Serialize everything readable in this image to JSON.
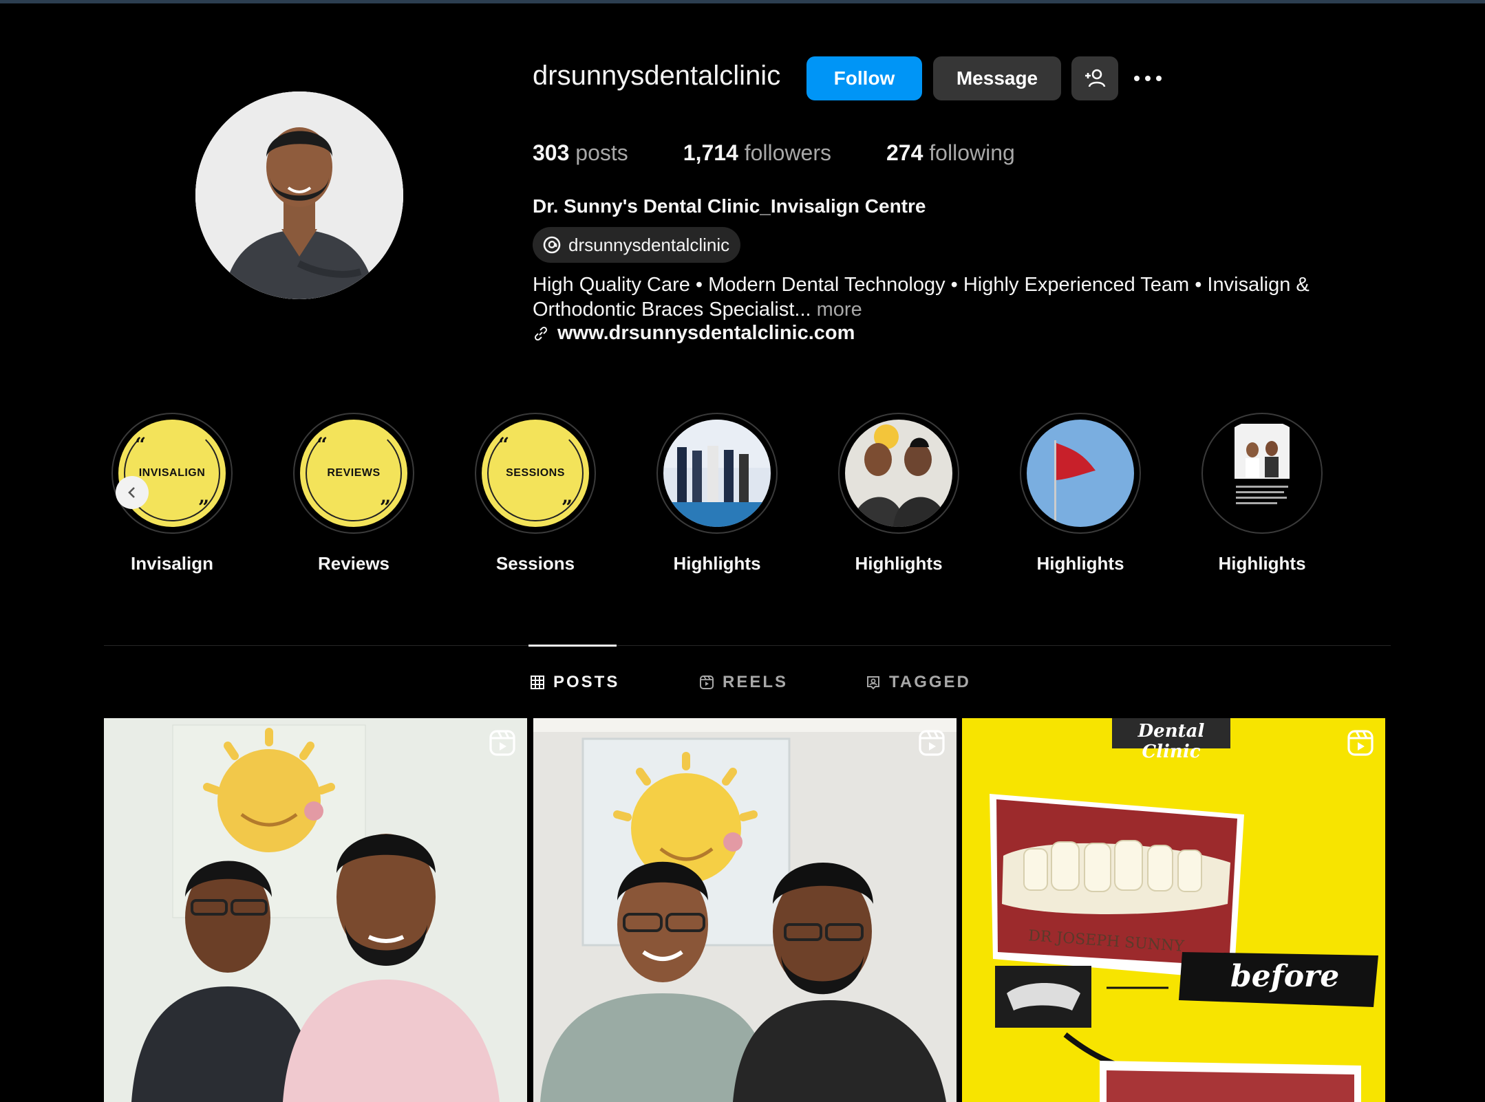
{
  "profile": {
    "username": "drsunnysdentalclinic",
    "follow_label": "Follow",
    "message_label": "Message",
    "stats": {
      "posts_count": "303",
      "posts_label": "posts",
      "followers_count": "1,714",
      "followers_label": "followers",
      "following_count": "274",
      "following_label": "following"
    },
    "full_name": "Dr. Sunny's Dental Clinic_Invisalign Centre",
    "threads_handle": "drsunnysdentalclinic",
    "bio_line1": "High Quality Care • Modern Dental Technology • Highly Experienced Team • Invisalign &",
    "bio_line2": "Orthodontic Braces Specialist...",
    "bio_more": "more",
    "website": "www.drsunnysdentalclinic.com"
  },
  "highlights": [
    {
      "label": "Invisalign",
      "cover_text": "INVISALIGN"
    },
    {
      "label": "Reviews",
      "cover_text": "REVIEWS"
    },
    {
      "label": "Sessions",
      "cover_text": "SESSIONS"
    },
    {
      "label": "Highlights"
    },
    {
      "label": "Highlights"
    },
    {
      "label": "Highlights"
    },
    {
      "label": "Highlights"
    }
  ],
  "tabs": [
    {
      "label": "POSTS",
      "active": true
    },
    {
      "label": "REELS",
      "active": false
    },
    {
      "label": "TAGGED",
      "active": false
    }
  ],
  "posts": [
    {
      "type": "reel",
      "caption": ""
    },
    {
      "type": "reel",
      "caption": ""
    },
    {
      "type": "reel",
      "header": "Dental Clinic",
      "watermark": "DR JOSEPH SUNNY",
      "tag": "before"
    }
  ],
  "colors": {
    "background": "#000000",
    "follow_button": "#0095f6",
    "secondary_button": "#363636",
    "highlight_yellow": "#f3e35a",
    "post_yellow": "#f7e400"
  },
  "icons": [
    "add-user-icon",
    "more-icon",
    "threads-icon",
    "link-icon",
    "chevron-left-icon",
    "grid-icon",
    "reels-icon",
    "tagged-icon",
    "reel-badge-icon"
  ]
}
